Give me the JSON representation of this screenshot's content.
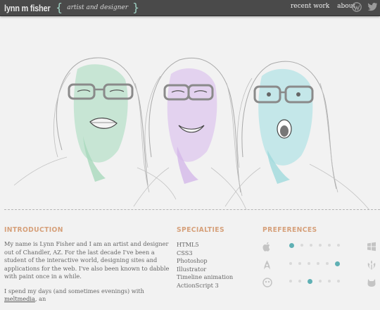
{
  "header": {
    "brand": "lynn m fisher",
    "brace_open": "{",
    "tagline": "artist and designer",
    "brace_close": "}",
    "nav": [
      "recent work",
      "about"
    ],
    "social": [
      "wordpress-icon",
      "twitter-icon"
    ]
  },
  "colors": {
    "header_bg": "#4a4a4a",
    "accent_teal": "#9fd2c4",
    "heading_orange": "#d6a07a",
    "dot_active": "#5fb0b4",
    "face_green": "#8fcfa9",
    "face_purple": "#c9a6e0",
    "face_cyan": "#7fd0d3"
  },
  "introduction": {
    "title": "INTRODUCTION",
    "p1": "My name is Lynn Fisher and I am an artist and designer out of Chandler, AZ. For the last decade I've been a student of the interactive world, designing sites and applications for the web. I've also been known to dabble with paint once in a while.",
    "p2_before": "I spend my days (and sometimes evenings) with ",
    "p2_link": "meltmedia",
    "p2_after": ", an"
  },
  "specialties": {
    "title": "SPECIALTIES",
    "items": [
      "HTML5",
      "CSS3",
      "Photoshop",
      "Illustrator",
      "Timeline animation",
      "ActionScript 3"
    ]
  },
  "preferences": {
    "title": "PREFERENCES",
    "rows": [
      {
        "left": "apple-icon",
        "right": "windows-icon",
        "active": 1
      },
      {
        "left": "starfleet-icon",
        "right": "rebel-alliance-icon",
        "active": 5
      },
      {
        "left": "robot-icon",
        "right": "cat-icon",
        "active": 2
      }
    ]
  }
}
